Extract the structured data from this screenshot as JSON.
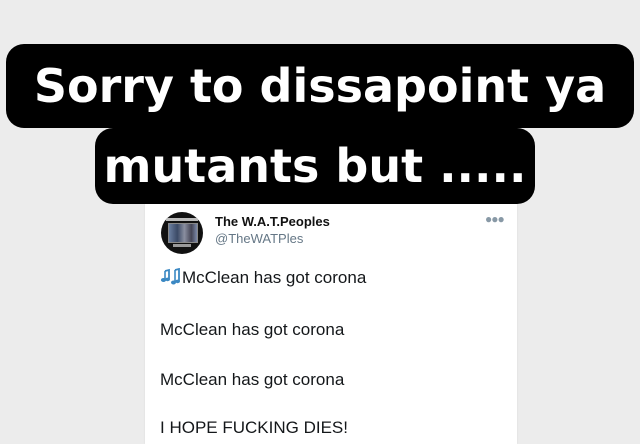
{
  "overlay": {
    "line1": "Sorry to dissapoint ya",
    "line2": "mutants but ....."
  },
  "tweet": {
    "display_name": "The W.A.T.Peoples",
    "handle": "@TheWATPles",
    "more_icon": "ellipsis-icon",
    "lines": [
      {
        "icon": "music-notes-icon",
        "text": "McClean has got corona"
      },
      {
        "text": "McClean has got corona"
      },
      {
        "text": "McClean has got corona"
      },
      {
        "text": "I HOPE FUCKING DIES!"
      }
    ]
  },
  "colors": {
    "background": "#ececec",
    "overlay_bg": "#000000",
    "overlay_text": "#ffffff",
    "handle": "#657786",
    "music_icon": "#3b88c3"
  }
}
